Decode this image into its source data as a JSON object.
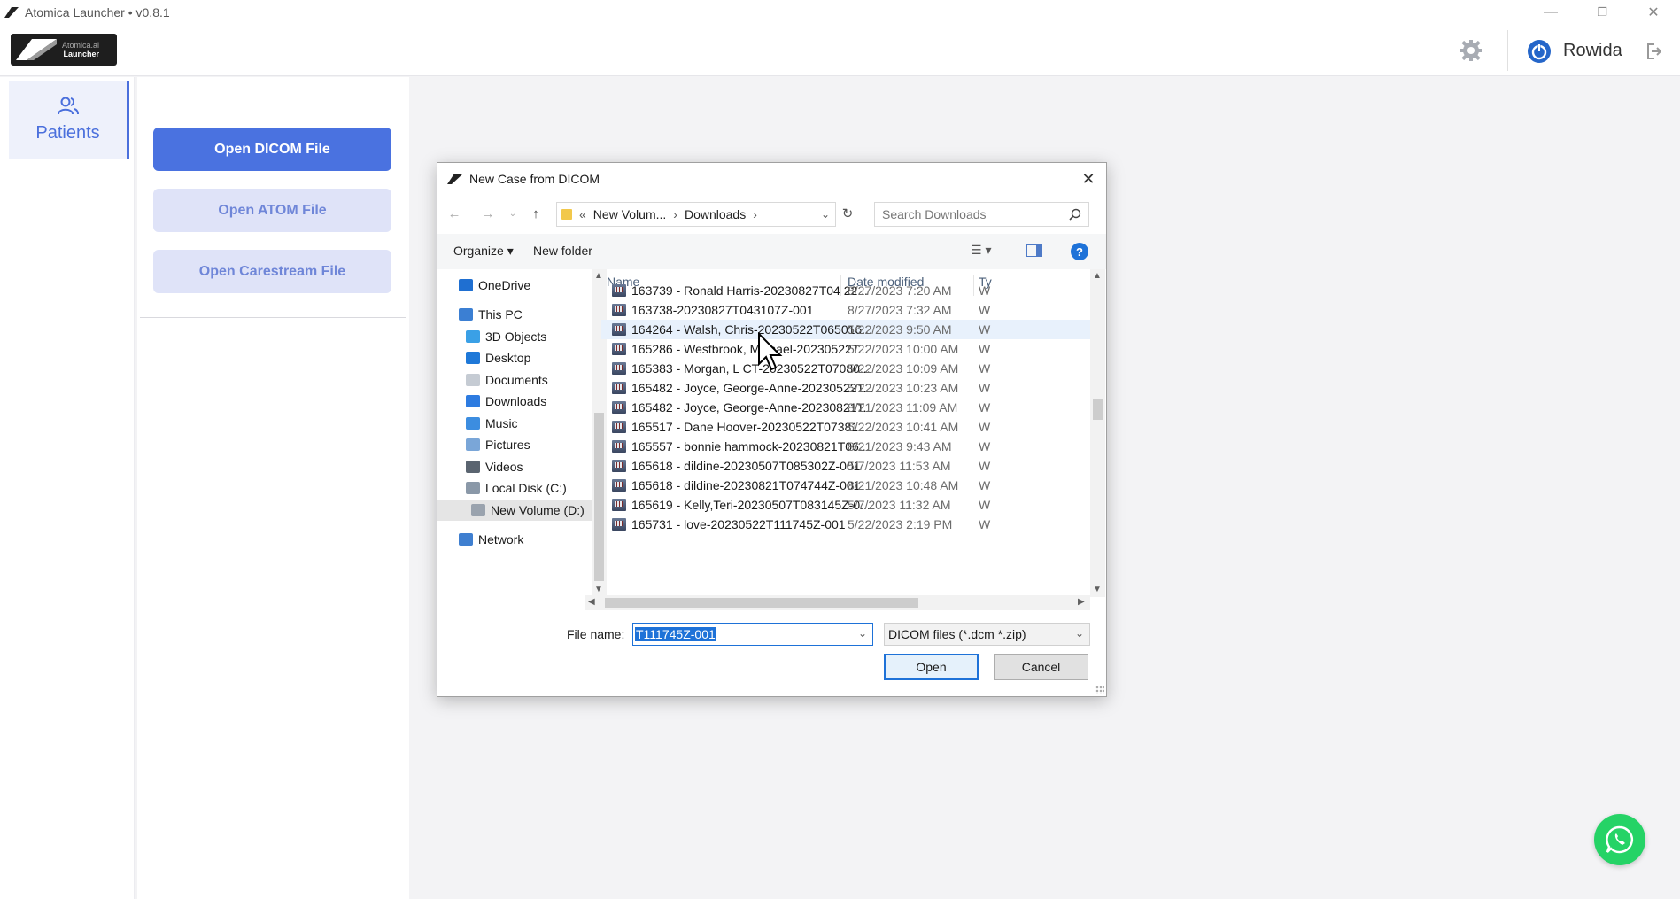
{
  "window": {
    "title": "Atomica Launcher • v0.8.1",
    "minimize": "—",
    "restore": "❐",
    "close": "✕"
  },
  "header": {
    "logo_text_line1": "Atomica.ai",
    "logo_text_line2": "Launcher",
    "username": "Rowida"
  },
  "nav": {
    "patients_label": "Patients"
  },
  "side_panel": {
    "open_dicom": "Open DICOM File",
    "open_atom": "Open ATOM File",
    "open_carestream": "Open Carestream File"
  },
  "dialog": {
    "title": "New Case from DICOM",
    "close": "✕",
    "address": {
      "crumbs_prefix": "«",
      "crumb1": "New Volum...",
      "crumb2": "Downloads",
      "sep": "›"
    },
    "search_placeholder": "Search Downloads",
    "toolbar": {
      "organize": "Organize ▾",
      "new_folder": "New folder",
      "help": "?"
    },
    "tree": [
      {
        "label": "OneDrive",
        "color": "#1f6fd1"
      },
      {
        "label": "This PC",
        "color": "#3b7fd3"
      },
      {
        "label": "3D Objects",
        "color": "#3aa0e6"
      },
      {
        "label": "Desktop",
        "color": "#1e78d8"
      },
      {
        "label": "Documents",
        "color": "#c5cbd3"
      },
      {
        "label": "Downloads",
        "color": "#2d7be0"
      },
      {
        "label": "Music",
        "color": "#3c8de0"
      },
      {
        "label": "Pictures",
        "color": "#7aa6d8"
      },
      {
        "label": "Videos",
        "color": "#5a6470"
      },
      {
        "label": "Local Disk (C:)",
        "color": "#8a98a8"
      },
      {
        "label": "New Volume (D:)",
        "color": "#9aa3ae"
      },
      {
        "label": "Network",
        "color": "#3f7fd0"
      }
    ],
    "columns": {
      "name": "Name",
      "date": "Date modified",
      "type": "Ty"
    },
    "files": [
      {
        "name": "163739 - Ronald Harris-20230827T04 22...",
        "date": "8/27/2023 7:20 AM",
        "type": "W"
      },
      {
        "name": "163738-20230827T043107Z-001",
        "date": "8/27/2023 7:32 AM",
        "type": "W"
      },
      {
        "name": "164264 - Walsh, Chris-20230522T065016...",
        "date": "5/22/2023 9:50 AM",
        "type": "W"
      },
      {
        "name": "165286 - Westbrook, Michael-20230522T...",
        "date": "5/22/2023 10:00 AM",
        "type": "W"
      },
      {
        "name": "165383 - Morgan, L CT-20230522T07080...",
        "date": "5/22/2023 10:09 AM",
        "type": "W"
      },
      {
        "name": "165482 - Joyce, George-Anne-20230522T...",
        "date": "5/22/2023 10:23 AM",
        "type": "W"
      },
      {
        "name": "165482 - Joyce, George-Anne-20230821T...",
        "date": "8/21/2023 11:09 AM",
        "type": "W"
      },
      {
        "name": "165517 - Dane Hoover-20230522T07381...",
        "date": "5/22/2023 10:41 AM",
        "type": "W"
      },
      {
        "name": "165557 - bonnie hammock-20230821T06...",
        "date": "8/21/2023 9:43 AM",
        "type": "W"
      },
      {
        "name": "165618 - dildine-20230507T085302Z-001",
        "date": "5/7/2023 11:53 AM",
        "type": "W"
      },
      {
        "name": "165618 - dildine-20230821T074744Z-001",
        "date": "8/21/2023 10:48 AM",
        "type": "W"
      },
      {
        "name": "165619 - Kelly,Teri-20230507T083145Z-0...",
        "date": "5/7/2023 11:32 AM",
        "type": "W"
      },
      {
        "name": "165731 - love-20230522T111745Z-001",
        "date": "5/22/2023 2:19 PM",
        "type": "W"
      }
    ],
    "file_name_label": "File name:",
    "file_name_value": "T111745Z-001",
    "filter_value": "DICOM files (*.dcm *.zip)",
    "open_button": "Open",
    "cancel_button": "Cancel"
  },
  "colors": {
    "accent": "#4a72e0",
    "accent_light": "#dfe3f8",
    "whatsapp": "#25d366"
  }
}
